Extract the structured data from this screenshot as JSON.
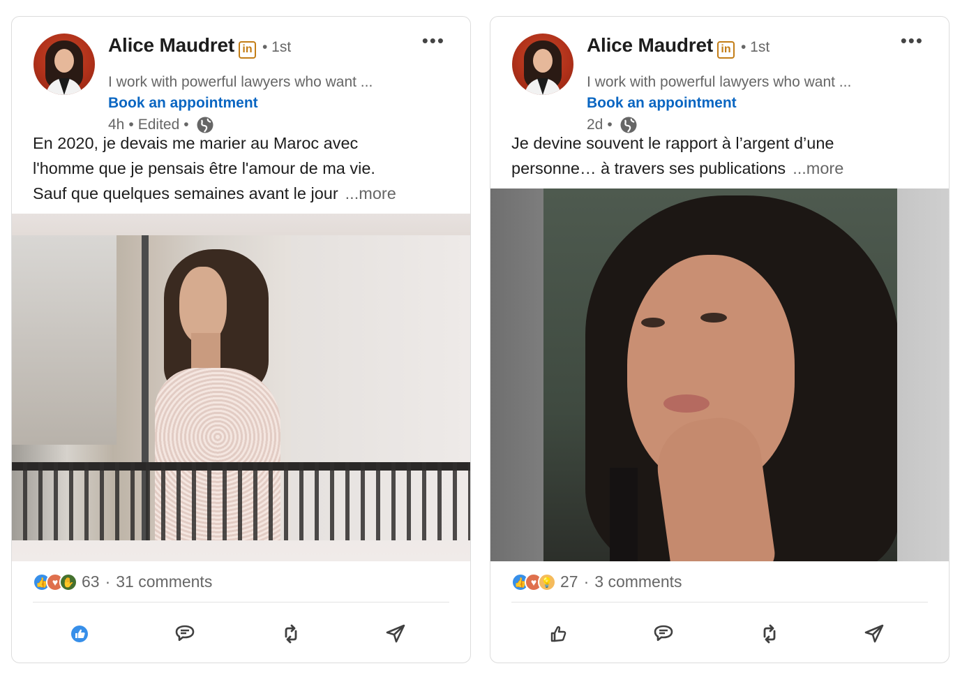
{
  "posts": [
    {
      "author": {
        "name": "Alice Maudret",
        "badge": "in",
        "degree": "• 1st",
        "headline": "I work with powerful lawyers who want ...",
        "cta": "Book an appointment"
      },
      "meta": {
        "time": "4h",
        "edited": "Edited"
      },
      "text_lines": [
        "En 2020, je devais me marier au Maroc avec",
        "l'homme que je pensais être l'amour de ma vie.",
        "Sauf que quelques semaines avant le jour"
      ],
      "more_label": "...more",
      "reaction_icons": [
        "like-icon",
        "love-icon",
        "support-icon"
      ],
      "reaction_count": "63",
      "comments": "31 comments",
      "liked": true,
      "colors": {
        "liked": "#378fe9"
      }
    },
    {
      "author": {
        "name": "Alice Maudret",
        "badge": "in",
        "degree": "• 1st",
        "headline": "I work with powerful lawyers who want ...",
        "cta": "Book an appointment"
      },
      "meta": {
        "time": "2d"
      },
      "text_lines": [
        "Je devine souvent le rapport à l’argent d’une",
        "personne… à travers ses publications"
      ],
      "more_label": "...more",
      "reaction_icons": [
        "like-icon",
        "love-icon",
        "insightful-icon"
      ],
      "reaction_count": "27",
      "comments": "3 comments",
      "liked": false
    }
  ],
  "theme": {
    "link": "#0a66c2",
    "secondary_text": "#666666",
    "badge": "#c37d16"
  }
}
